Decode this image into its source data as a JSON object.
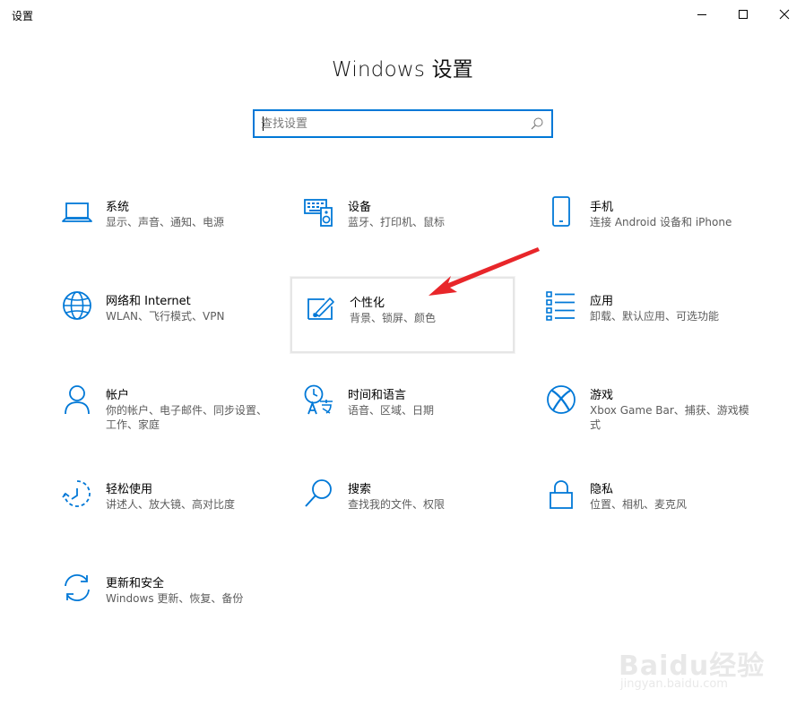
{
  "window": {
    "title": "设置",
    "controls": {
      "minimize_icon": "minimize-icon",
      "maximize_icon": "maximize-icon",
      "close_icon": "close-icon"
    }
  },
  "page": {
    "title": "Windows 设置"
  },
  "search": {
    "placeholder": "查找设置",
    "value": ""
  },
  "tiles": [
    {
      "id": "system",
      "icon": "laptop-icon",
      "title": "系统",
      "desc": "显示、声音、通知、电源"
    },
    {
      "id": "devices",
      "icon": "keyboard-speaker-icon",
      "title": "设备",
      "desc": "蓝牙、打印机、鼠标"
    },
    {
      "id": "phone",
      "icon": "phone-icon",
      "title": "手机",
      "desc": "连接 Android 设备和 iPhone"
    },
    {
      "id": "network",
      "icon": "globe-icon",
      "title": "网络和 Internet",
      "desc": "WLAN、飞行模式、VPN"
    },
    {
      "id": "personalization",
      "icon": "paint-brush-icon",
      "title": "个性化",
      "desc": "背景、锁屏、颜色"
    },
    {
      "id": "apps",
      "icon": "apps-list-icon",
      "title": "应用",
      "desc": "卸载、默认应用、可选功能"
    },
    {
      "id": "accounts",
      "icon": "person-icon",
      "title": "帐户",
      "desc": "你的帐户、电子邮件、同步设置、工作、家庭"
    },
    {
      "id": "time",
      "icon": "time-language-icon",
      "title": "时间和语言",
      "desc": "语音、区域、日期"
    },
    {
      "id": "gaming",
      "icon": "xbox-icon",
      "title": "游戏",
      "desc": "Xbox Game Bar、捕获、游戏模式"
    },
    {
      "id": "ease",
      "icon": "ease-of-access-icon",
      "title": "轻松使用",
      "desc": "讲述人、放大镜、高对比度"
    },
    {
      "id": "search",
      "icon": "magnifier-icon",
      "title": "搜索",
      "desc": "查找我的文件、权限"
    },
    {
      "id": "privacy",
      "icon": "lock-icon",
      "title": "隐私",
      "desc": "位置、相机、麦克风"
    },
    {
      "id": "update",
      "icon": "sync-icon",
      "title": "更新和安全",
      "desc": "Windows 更新、恢复、备份"
    }
  ],
  "watermark": {
    "main": "Baidu经验",
    "sub": "jingyan.baidu.com"
  },
  "colors": {
    "accent": "#0078d7",
    "annotation_arrow": "#e8262a"
  }
}
